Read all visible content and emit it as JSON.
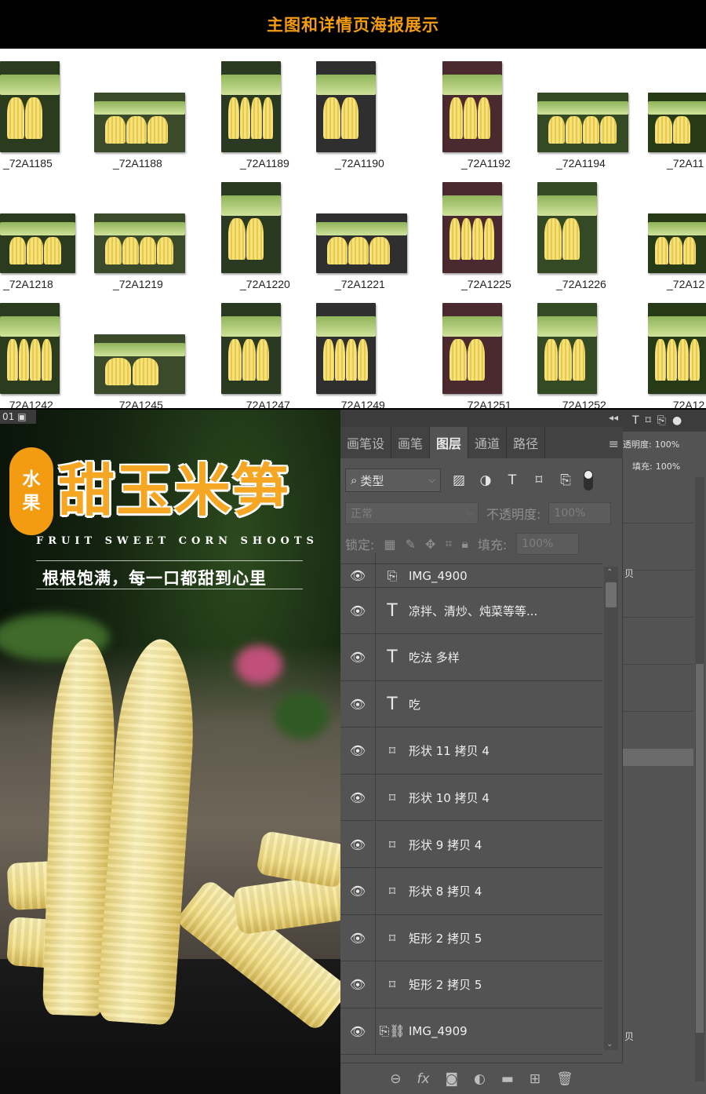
{
  "banner": {
    "title": "主图和详情页海报展示"
  },
  "thumbnails": [
    {
      "label": "_72A1185"
    },
    {
      "label": "_72A1188"
    },
    {
      "label": "_72A1189"
    },
    {
      "label": "_72A1190"
    },
    {
      "label": "_72A1192"
    },
    {
      "label": "_72A1194"
    },
    {
      "label": "_72A11"
    },
    {
      "label": "_72A1218"
    },
    {
      "label": "_72A1219"
    },
    {
      "label": "_72A1220"
    },
    {
      "label": "_72A1221"
    },
    {
      "label": "_72A1225"
    },
    {
      "label": "_72A1226"
    },
    {
      "label": "_72A12"
    },
    {
      "label": "_72A1242"
    },
    {
      "label": "_72A1245"
    },
    {
      "label": "_72A1247"
    },
    {
      "label": "_72A1249"
    },
    {
      "label": "_72A1251"
    },
    {
      "label": "_72A1252"
    },
    {
      "label": "_72A12"
    }
  ],
  "poster": {
    "tab_label": "01",
    "badge_line1": "水",
    "badge_line2": "果",
    "title": "甜玉米笋",
    "english": "FRUIT SWEET CORN SHOOTS",
    "slogan": "根根饱满，每一口都甜到心里"
  },
  "ps": {
    "collapse": "◂◂",
    "tabs": [
      "画笔设",
      "画笔",
      "图层",
      "通道",
      "路径"
    ],
    "active_tab": "图层",
    "menu_icon": "≡",
    "filter_kind": "类型",
    "blend_mode": "正常",
    "opacity_label": "不透明度:",
    "opacity_value": "100%",
    "lock_label": "锁定:",
    "fill_label": "填充:",
    "fill_value": "100%",
    "layers": [
      {
        "name": "IMG_4900",
        "kind": "smart"
      },
      {
        "name": "凉拌、清炒、炖菜等等...",
        "kind": "text"
      },
      {
        "name": "吃法 多样",
        "kind": "text"
      },
      {
        "name": "吃",
        "kind": "text"
      },
      {
        "name": "形状 11 拷贝 4",
        "kind": "shape"
      },
      {
        "name": "形状 10 拷贝 4",
        "kind": "shape"
      },
      {
        "name": "形状 9 拷贝 4",
        "kind": "shape"
      },
      {
        "name": "形状 8 拷贝 4",
        "kind": "shape"
      },
      {
        "name": "矩形 2 拷贝 5",
        "kind": "shape"
      },
      {
        "name": "矩形 2 拷贝 5",
        "kind": "shape"
      },
      {
        "name": "IMG_4909",
        "kind": "smart-linked"
      }
    ],
    "footer_icons": [
      "link-icon",
      "fx-icon",
      "mask-icon",
      "adjustment-icon",
      "folder-icon",
      "new-layer-icon",
      "trash-icon"
    ],
    "right": {
      "opacity_label": "透明度:",
      "opacity_value": "100%",
      "fill_label": "填充:",
      "fill_value": "100%",
      "row_text_1": "贝",
      "row_text_2": "贝"
    }
  }
}
